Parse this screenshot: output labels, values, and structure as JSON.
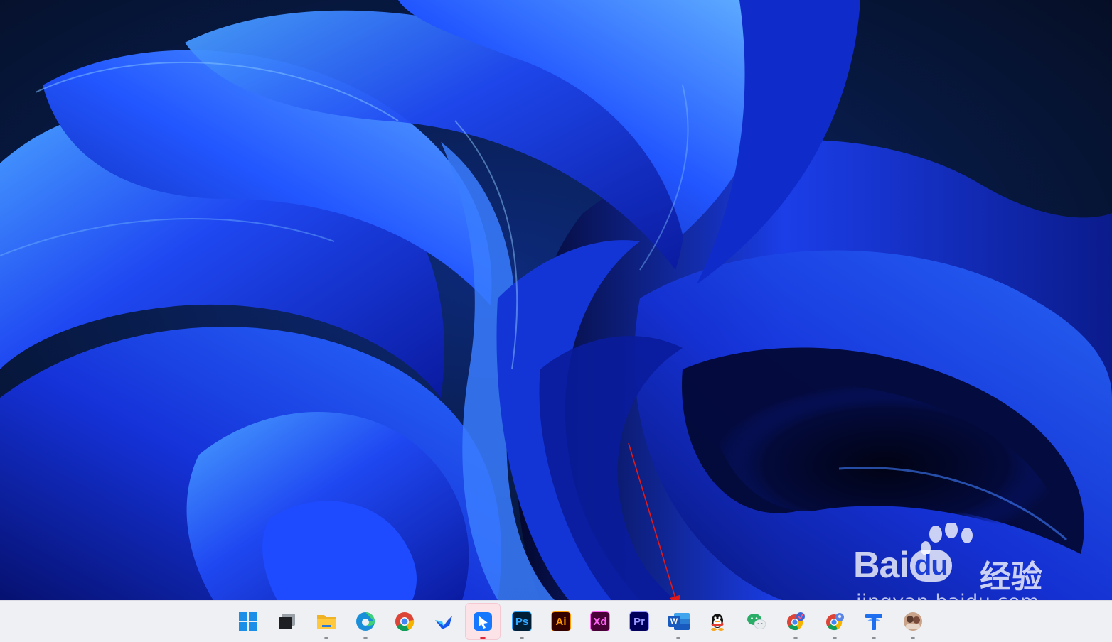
{
  "wallpaper": {
    "name": "Windows 11 Bloom",
    "colors": {
      "base": "#05122a",
      "deep": "#0a1a8a",
      "mid": "#1c3df0",
      "light": "#3f8cff"
    }
  },
  "watermark": {
    "logo_prefix": "Bai",
    "logo_badge": "du",
    "logo_suffix": "经验",
    "url": "jingyan.baidu.com"
  },
  "annotation": {
    "arrow_color": "#e01a1a",
    "target": "taskbar-word-button"
  },
  "taskbar": {
    "background": "#eef0f4",
    "items": [
      {
        "id": "start",
        "icon": "windows-start-icon",
        "running": false
      },
      {
        "id": "task-view",
        "icon": "task-view-icon",
        "running": false
      },
      {
        "id": "file-explorer",
        "icon": "folder-icon",
        "running": true
      },
      {
        "id": "edge",
        "icon": "edge-icon",
        "running": true
      },
      {
        "id": "chrome",
        "icon": "chrome-icon",
        "running": false
      },
      {
        "id": "feishu",
        "icon": "bird-app-icon",
        "running": false
      },
      {
        "id": "active-app",
        "icon": "blue-arrow-app-icon",
        "running": true,
        "active": true
      },
      {
        "id": "photoshop",
        "icon": "photoshop-icon",
        "label": "Ps",
        "running": true
      },
      {
        "id": "illustrator",
        "icon": "illustrator-icon",
        "label": "Ai",
        "running": false
      },
      {
        "id": "xd",
        "icon": "xd-icon",
        "label": "Xd",
        "running": false
      },
      {
        "id": "premiere",
        "icon": "premiere-icon",
        "label": "Pr",
        "running": false
      },
      {
        "id": "word",
        "icon": "word-icon",
        "label": "W",
        "running": true
      },
      {
        "id": "qq",
        "icon": "qq-penguin-icon",
        "running": false
      },
      {
        "id": "wechat",
        "icon": "wechat-icon",
        "running": false
      },
      {
        "id": "chrome-profile-1",
        "icon": "chrome-profile-icon",
        "running": true
      },
      {
        "id": "chrome-profile-2",
        "icon": "chrome-profile-icon",
        "running": true
      },
      {
        "id": "translate-app",
        "icon": "pin-app-icon",
        "running": true
      },
      {
        "id": "user-app",
        "icon": "avatar-icon",
        "running": true
      }
    ]
  }
}
